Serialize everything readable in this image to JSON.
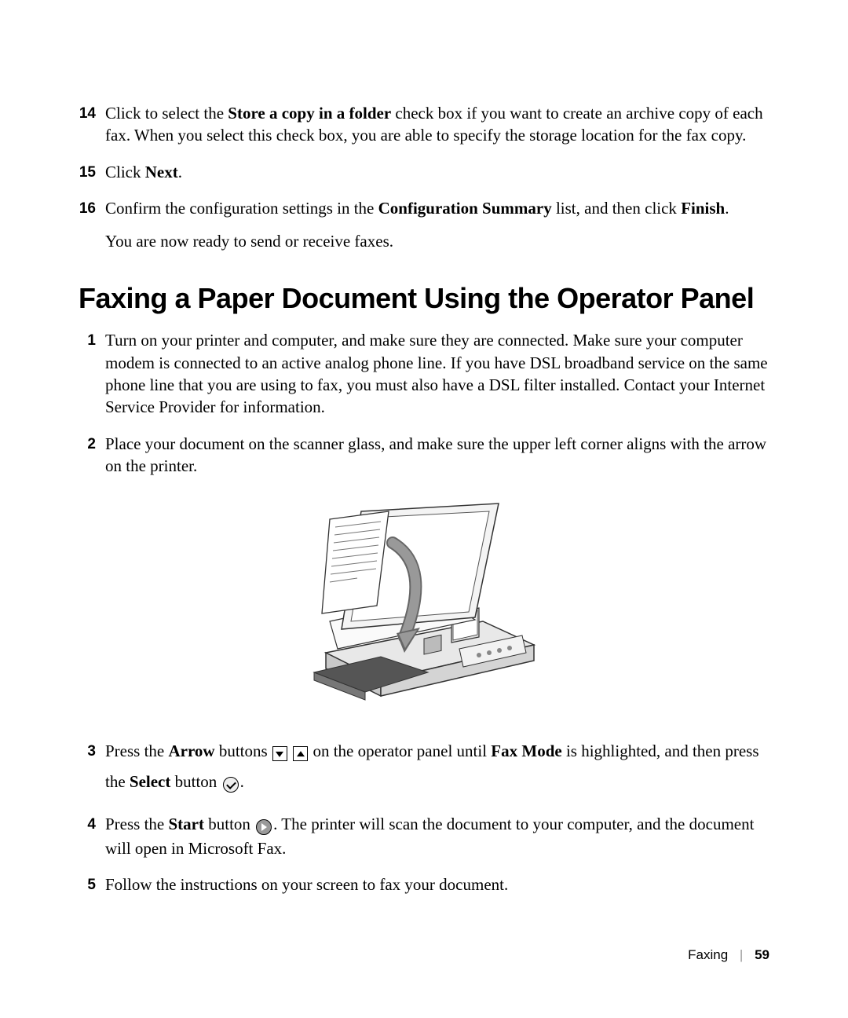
{
  "steps_a": [
    {
      "num": "14",
      "pre": "Click to select the ",
      "bold1": "Store a copy in a folder",
      "post1": " check box if you want to create an archive copy of each fax. When you select this check box, you are able to specify the storage location for the fax copy."
    },
    {
      "num": "15",
      "pre": "Click ",
      "bold1": "Next",
      "post1": "."
    },
    {
      "num": "16",
      "pre": "Confirm the configuration settings in the ",
      "bold1": "Configuration Summary",
      "post1": " list, and then click ",
      "bold2": "Finish",
      "post2": "."
    }
  ],
  "note_a": "You are now ready to send or receive faxes.",
  "heading": "Faxing a Paper Document Using the Operator Panel",
  "steps_b": [
    {
      "num": "1",
      "text": "Turn on your printer and computer, and make sure they are connected. Make sure your computer modem is connected to an active analog phone line. If you have DSL broadband service on the same phone line that you are using to fax, you must also have a DSL filter installed. Contact your Internet Service Provider for information."
    },
    {
      "num": "2",
      "text": "Place your document on the scanner glass, and make sure the upper left corner aligns with the arrow on the printer."
    }
  ],
  "step3": {
    "num": "3",
    "t1": "Press the ",
    "b1": "Arrow",
    "t2": " buttons ",
    "t3": " on the operator panel until ",
    "b2": "Fax Mode",
    "t4": " is highlighted, and then press the ",
    "b3": "Select",
    "t5": " button ",
    "t6": "."
  },
  "step4": {
    "num": "4",
    "t1": "Press the ",
    "b1": "Start",
    "t2": " button ",
    "t3": ". The printer will scan the document to your computer, and the document will open in Microsoft Fax."
  },
  "step5": {
    "num": "5",
    "text": "Follow the instructions on your screen to fax your document."
  },
  "footer": {
    "section": "Faxing",
    "page": "59"
  }
}
